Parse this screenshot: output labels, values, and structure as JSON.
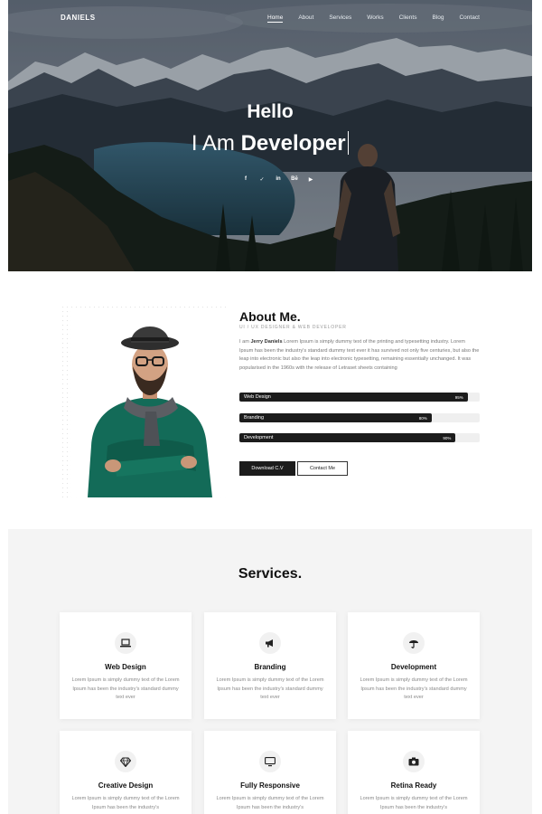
{
  "nav": {
    "brand": "DANIELS",
    "items": [
      "Home",
      "About",
      "Services",
      "Works",
      "Clients",
      "Blog",
      "Contact"
    ],
    "active": "Home"
  },
  "hero": {
    "hello": "Hello",
    "tagline_light": "I Am",
    "tagline_bold": "Developer",
    "social_icons": [
      {
        "name": "facebook-icon",
        "glyph": "f"
      },
      {
        "name": "twitter-icon",
        "glyph": "✓"
      },
      {
        "name": "linkedin-icon",
        "glyph": "in"
      },
      {
        "name": "behance-icon",
        "glyph": "Bē"
      },
      {
        "name": "youtube-icon",
        "glyph": "▶"
      }
    ]
  },
  "about": {
    "title": "About Me.",
    "subtitle": "UI / UX DESIGNER & WEB DEVELOPER",
    "text_intro": "I am ",
    "text_name": "Jerry Daniels",
    "text_body": " Lorem Ipsum is simply dummy text of the printing and typesetting industry. Lorem Ipsum has been the industry's standard dummy text ever it has survived not only five centuries, but also the leap into electronic but also the leap into electronic typesetting, remaining essentially unchanged. It was popularised in the 1960s with the release of Letraset sheets containing",
    "skills": [
      {
        "name": "Web Design",
        "percent": 95,
        "label": "95%"
      },
      {
        "name": "Branding",
        "percent": 80,
        "label": "80%"
      },
      {
        "name": "Development",
        "percent": 90,
        "label": "90%"
      }
    ],
    "download_button": "Download C.V",
    "contact_button": "Contact Me"
  },
  "services": {
    "title": "Services.",
    "items": [
      {
        "title": "Web Design",
        "desc": "Lorem Ipsum is simply dummy text of the Lorem Ipsum has been the industry's standard dummy text ever",
        "icon": "laptop-icon"
      },
      {
        "title": "Branding",
        "desc": "Lorem Ipsum is simply dummy text of the Lorem Ipsum has been the industry's standard dummy text ever",
        "icon": "megaphone-icon"
      },
      {
        "title": "Development",
        "desc": "Lorem Ipsum is simply dummy text of the Lorem Ipsum has been the industry's standard dummy text ever",
        "icon": "umbrella-icon"
      },
      {
        "title": "Creative Design",
        "desc": "Lorem Ipsum is simply dummy text of the Lorem Ipsum has been the industry's",
        "icon": "diamond-icon"
      },
      {
        "title": "Fully Responsive",
        "desc": "Lorem Ipsum is simply dummy text of the Lorem Ipsum has been the industry's",
        "icon": "monitor-icon"
      },
      {
        "title": "Retina Ready",
        "desc": "Lorem Ipsum is simply dummy text of the Lorem Ipsum has been the industry's",
        "icon": "camera-icon"
      }
    ]
  },
  "colors": {
    "dark": "#1c1c1c",
    "section_bg": "#f4f4f4"
  }
}
